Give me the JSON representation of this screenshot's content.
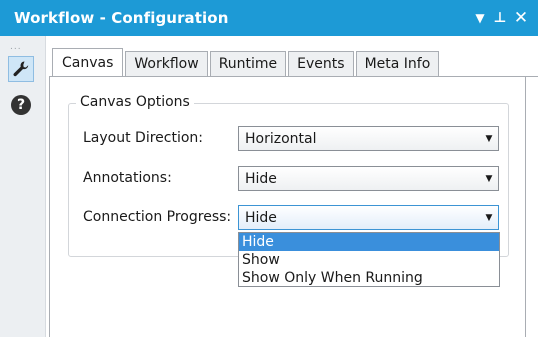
{
  "window": {
    "title": "Workflow - Configuration",
    "controls": [
      "dropdown-arrow",
      "pin",
      "close"
    ]
  },
  "toolbar": {
    "dots": "...",
    "buttons": [
      {
        "icon": "wrench-icon",
        "selected": true
      },
      {
        "icon": "help-icon",
        "glyph": "?"
      }
    ]
  },
  "tabs": [
    {
      "label": "Canvas",
      "active": true
    },
    {
      "label": "Workflow",
      "active": false
    },
    {
      "label": "Runtime",
      "active": false
    },
    {
      "label": "Events",
      "active": false
    },
    {
      "label": "Meta Info",
      "active": false
    }
  ],
  "canvas_options": {
    "legend": "Canvas Options",
    "fields": [
      {
        "label": "Layout Direction:",
        "value": "Horizontal"
      },
      {
        "label": "Annotations:",
        "value": "Hide"
      },
      {
        "label": "Connection Progress:",
        "value": "Hide",
        "open": true
      }
    ],
    "dropdown_options": [
      "Hide",
      "Show",
      "Show Only When Running"
    ],
    "dropdown_selected": "Hide"
  },
  "colors": {
    "title_bar": "#1d9ad6",
    "selected_option": "#3a8fdc"
  }
}
